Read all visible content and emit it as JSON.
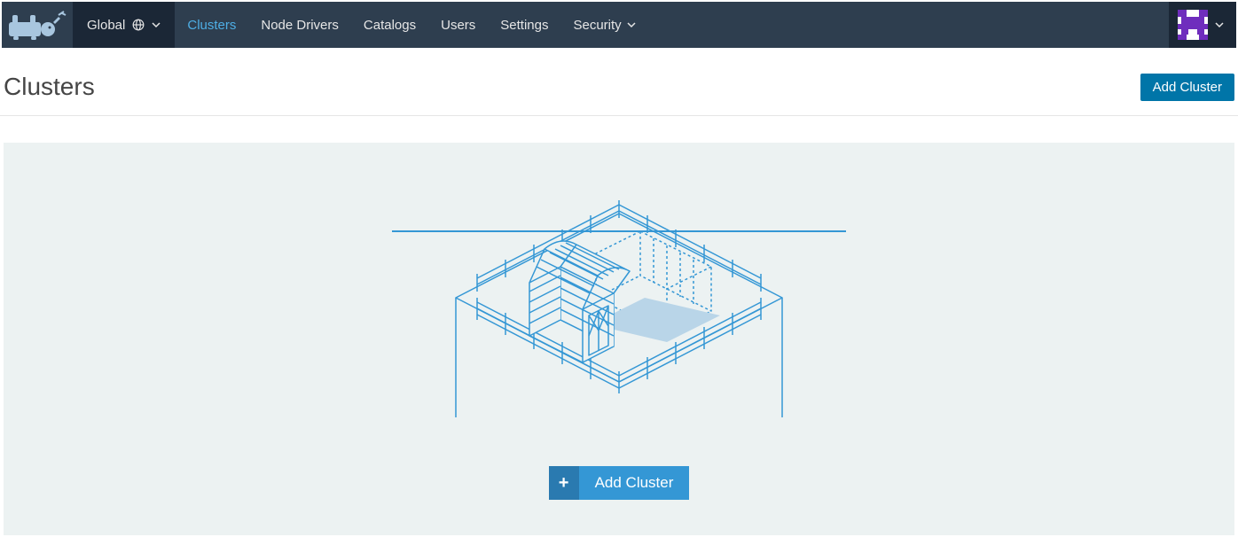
{
  "topbar": {
    "scope_label": "Global",
    "nav": [
      {
        "label": "Clusters",
        "active": true
      },
      {
        "label": "Node Drivers",
        "active": false
      },
      {
        "label": "Catalogs",
        "active": false
      },
      {
        "label": "Users",
        "active": false
      },
      {
        "label": "Settings",
        "active": false
      },
      {
        "label": "Security",
        "active": false,
        "has_chevron": true
      }
    ]
  },
  "page": {
    "title": "Clusters",
    "add_button": "Add Cluster"
  },
  "empty": {
    "add_button": "Add Cluster",
    "plus": "+"
  }
}
